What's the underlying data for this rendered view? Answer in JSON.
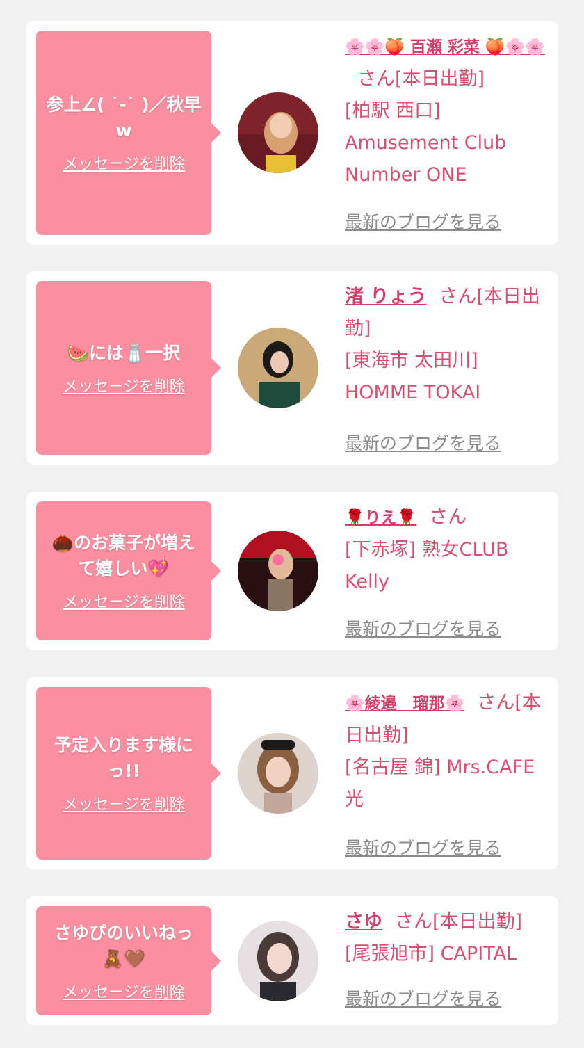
{
  "colors": {
    "background": "#f1f1f1",
    "card": "#ffffff",
    "bubble": "#f98fa0",
    "name": "#d4406a",
    "shop": "#d94f6f",
    "blog_link": "#8c8c8c"
  },
  "entries": [
    {
      "message": "参上∠( ˙-˙ )／秋早w",
      "delete_label": "メッセージを削除",
      "avatar_icon": "cast-photo-icon",
      "name": "🌸🌸🍑 百瀬 彩菜 🍑🌸🌸",
      "suffix": "さん[本日出勤]",
      "shop": "[柏駅 西口] Amusement Club Number ONE",
      "blog_label": "最新のブログを見る"
    },
    {
      "message": "🍉には🧂一択",
      "delete_label": "メッセージを削除",
      "avatar_icon": "cast-photo-icon",
      "name": "渚 りょう",
      "suffix": "さん[本日出勤]",
      "shop": "[東海市 太田川] HOMME TOKAI",
      "blog_label": "最新のブログを見る"
    },
    {
      "message": "🌰のお菓子が増えて嬉しい💖",
      "delete_label": "メッセージを削除",
      "avatar_icon": "cast-photo-icon",
      "name": "🌹りえ🌹",
      "suffix": "さん",
      "shop": "[下赤塚] 熟女CLUB Kelly",
      "blog_label": "最新のブログを見る"
    },
    {
      "message": "予定入ります様にっ!!",
      "delete_label": "メッセージを削除",
      "avatar_icon": "cast-photo-icon",
      "name": "🌸綾邉　瑠那🌸",
      "suffix": "さん[本日出勤]",
      "shop": "[名古屋 錦] Mrs.CAFE 光",
      "blog_label": "最新のブログを見る"
    },
    {
      "message": "さゆぴのいいねっ🧸🤎",
      "delete_label": "メッセージを削除",
      "avatar_icon": "cast-photo-icon",
      "name": "さゆ",
      "suffix": "さん[本日出勤]",
      "shop": "[尾張旭市] CAPITAL",
      "blog_label": "最新のブログを見る"
    }
  ]
}
